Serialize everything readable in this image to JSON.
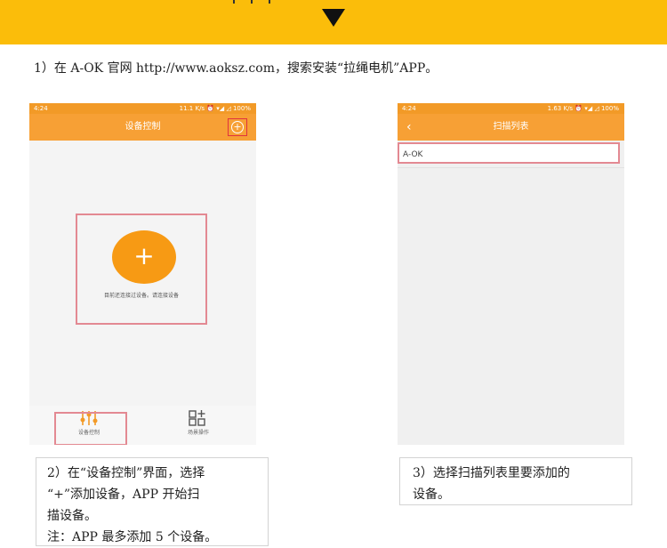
{
  "banner": {
    "color": "#fbbd0a",
    "arrow": "down-triangle"
  },
  "intro": "1）在 A-OK 官网 http://www.aoksz.com，搜索安装“拉绳电机”APP。",
  "phone1": {
    "status_time": "4:24",
    "status_right": "11.1 K/s ⏰ ▾◢ ◿ 100%",
    "title": "设备控制",
    "add_icon": "plus-circle-icon",
    "plus": "+",
    "hint": "目前还连接过设备。请连接设备",
    "tabs": [
      {
        "icon": "sliders-icon",
        "label": "设备控制"
      },
      {
        "icon": "grid-plus-icon",
        "label": "场景操作"
      }
    ]
  },
  "phone2": {
    "status_time": "4:24",
    "status_right": "1.63 K/s ⏰ ▾◢ ◿ 100%",
    "title": "扫描列表",
    "back": "‹",
    "item": "A-OK"
  },
  "note1": {
    "line1": "2）在“设备控制”界面，选择",
    "line2": "“+”添加设备，APP 开始扫",
    "line3": "描设备。",
    "line4": "注：APP 最多添加 5 个设备。"
  },
  "note2": {
    "line1": "3）选择扫描列表里要添加的",
    "line2": "设备。"
  },
  "colors": {
    "orange": "#f7a035",
    "highlight": "#e38992"
  }
}
